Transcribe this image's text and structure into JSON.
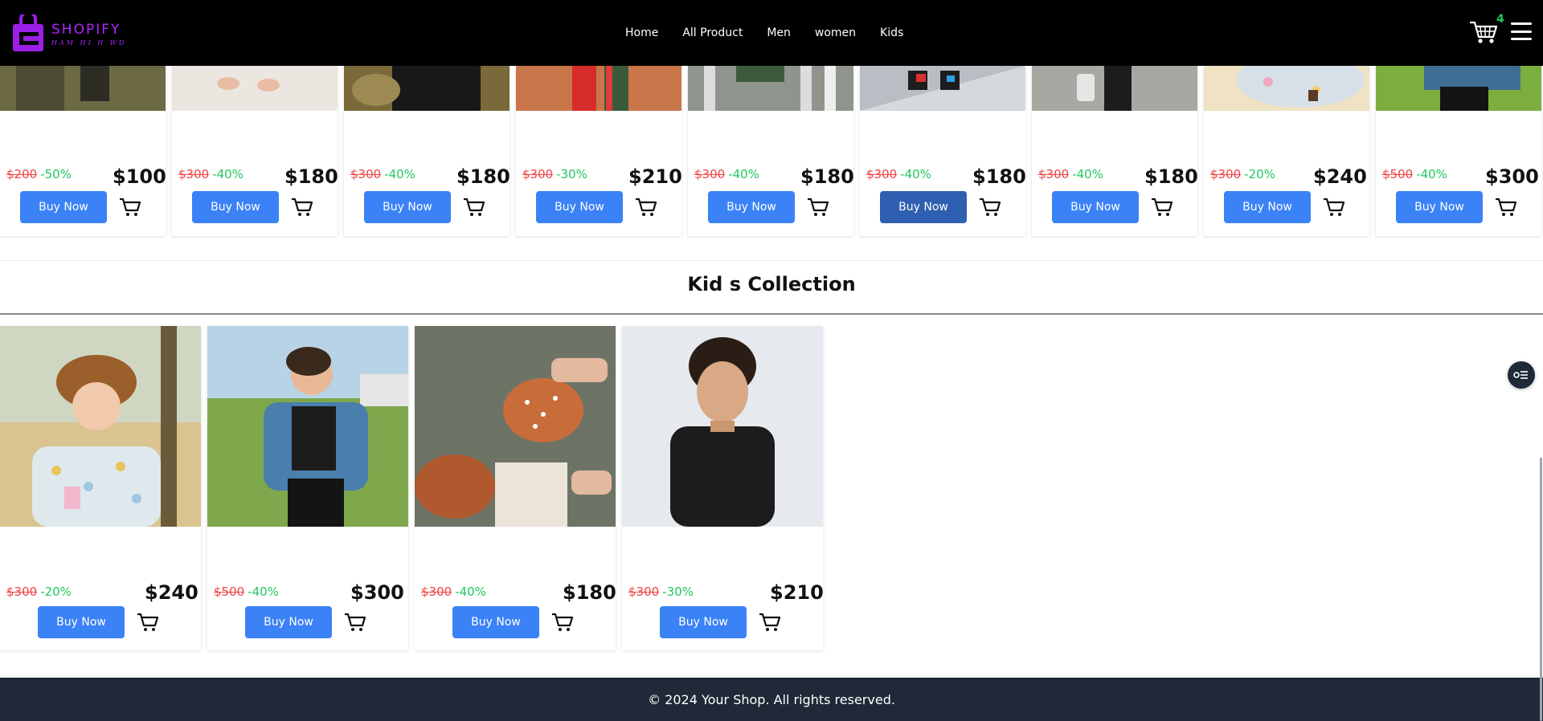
{
  "brand": {
    "name": "SHOPIFY",
    "tagline": "HAM HI H WD",
    "accent": "#b026ff"
  },
  "nav": {
    "links": [
      "Home",
      "All Product",
      "Men",
      "women",
      "Kids"
    ],
    "cart_count": "4"
  },
  "top_products": [
    {
      "old_price": "$200",
      "discount": "-50%",
      "price": "$100",
      "buy_label": "Buy Now"
    },
    {
      "old_price": "$300",
      "discount": "-40%",
      "price": "$180",
      "buy_label": "Buy Now"
    },
    {
      "old_price": "$300",
      "discount": "-40%",
      "price": "$180",
      "buy_label": "Buy Now"
    },
    {
      "old_price": "$300",
      "discount": "-30%",
      "price": "$210",
      "buy_label": "Buy Now"
    },
    {
      "old_price": "$300",
      "discount": "-40%",
      "price": "$180",
      "buy_label": "Buy Now"
    },
    {
      "old_price": "$300",
      "discount": "-40%",
      "price": "$180",
      "buy_label": "Buy Now"
    },
    {
      "old_price": "$300",
      "discount": "-40%",
      "price": "$180",
      "buy_label": "Buy Now"
    },
    {
      "old_price": "$300",
      "discount": "-20%",
      "price": "$240",
      "buy_label": "Buy Now"
    },
    {
      "old_price": "$500",
      "discount": "-40%",
      "price": "$300",
      "buy_label": "Buy Now"
    }
  ],
  "kids_section": {
    "title": "Kid s Collection",
    "products": [
      {
        "old_price": "$300",
        "discount": "-20%",
        "price": "$240",
        "buy_label": "Buy Now"
      },
      {
        "old_price": "$500",
        "discount": "-40%",
        "price": "$300",
        "buy_label": "Buy Now"
      },
      {
        "old_price": "$300",
        "discount": "-40%",
        "price": "$180",
        "buy_label": "Buy Now"
      },
      {
        "old_price": "$300",
        "discount": "-30%",
        "price": "$210",
        "buy_label": "Buy Now"
      }
    ]
  },
  "footer": {
    "text": "© 2024 Your Shop. All rights reserved."
  },
  "colors": {
    "buy_button": "#3b82f6",
    "old_price": "#ef4444",
    "discount": "#22c55e",
    "footer_bg": "#1f2937"
  }
}
